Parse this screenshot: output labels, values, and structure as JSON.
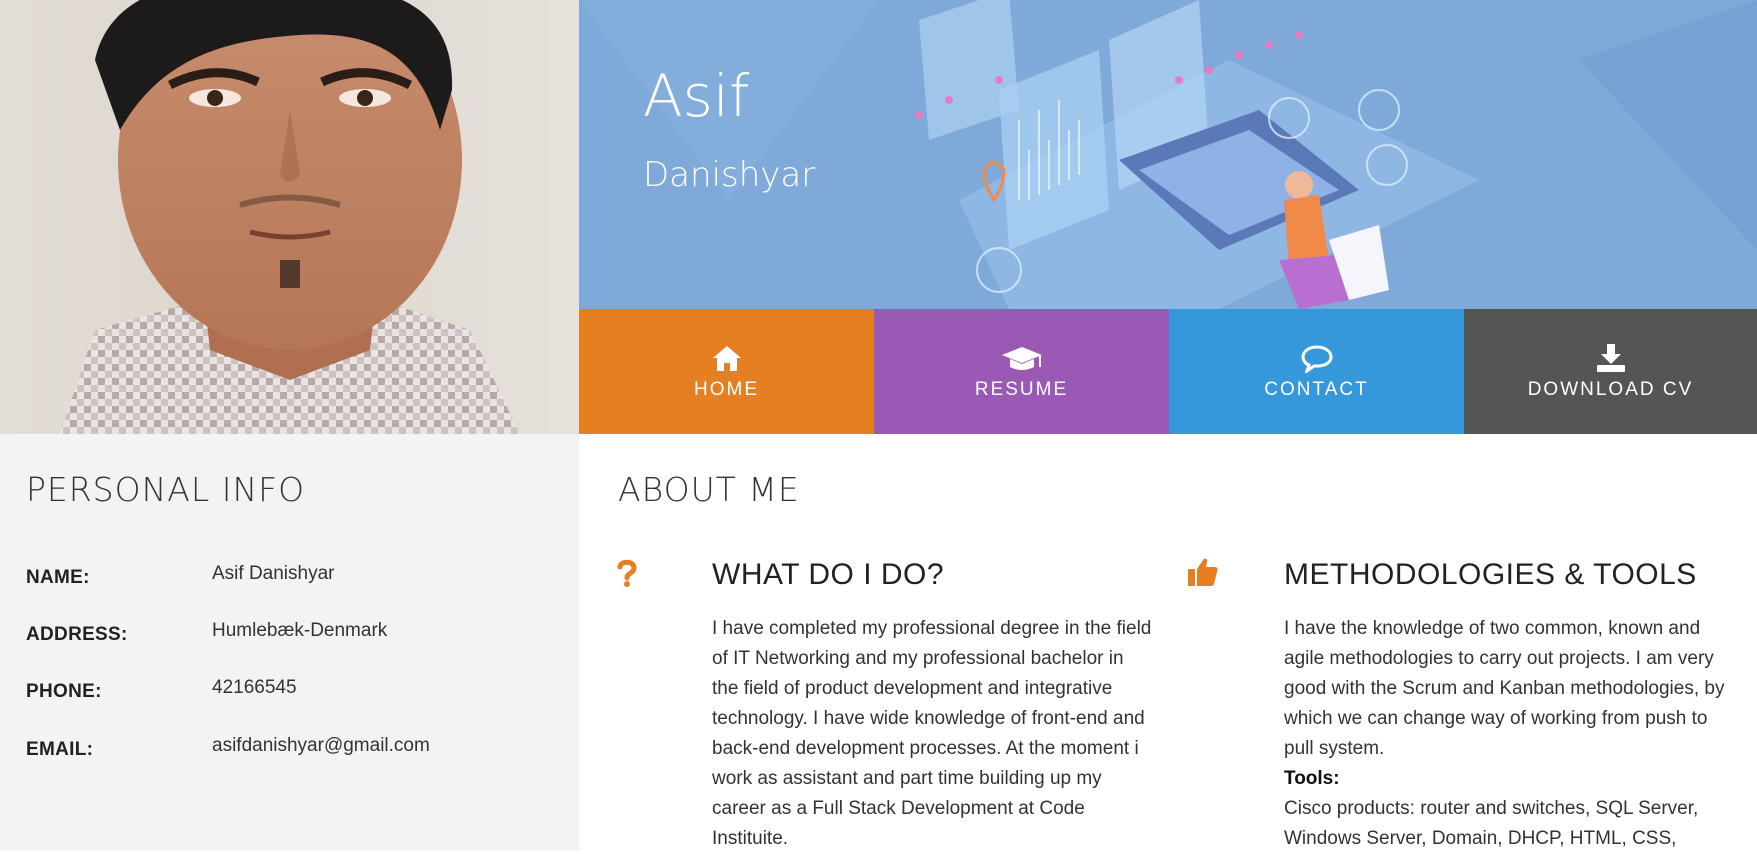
{
  "colors": {
    "home": "#e67e22",
    "resume": "#9b59b6",
    "contact": "#3498db",
    "download": "#555555",
    "accent": "#e67e22",
    "hero": "#7fa9d8",
    "sidebar": "#f3f3f3"
  },
  "profile": {
    "photo_alt": "Portrait photo"
  },
  "hero": {
    "first_name": "Asif",
    "last_name": "Danishyar"
  },
  "nav": [
    {
      "label": "HOME",
      "icon": "home-icon"
    },
    {
      "label": "RESUME",
      "icon": "graduation-cap-icon"
    },
    {
      "label": "CONTACT",
      "icon": "speech-bubble-icon"
    },
    {
      "label": "DOWNLOAD CV",
      "icon": "download-icon"
    }
  ],
  "personal": {
    "title": "PERSONAL INFO",
    "rows": [
      {
        "label": "NAME:",
        "value": "Asif Danishyar"
      },
      {
        "label": "ADDRESS:",
        "value": "Humlebæk-Denmark"
      },
      {
        "label": "PHONE:",
        "value": "42166545"
      },
      {
        "label": "EMAIL:",
        "value": "asifdanishyar@gmail.com"
      }
    ]
  },
  "about": {
    "title": "ABOUT ME",
    "features": [
      {
        "icon": "question-mark-icon",
        "title": "WHAT DO I DO?",
        "text": "I have completed my professional degree in the field of IT Networking and my professional bachelor in the field of product development and integrative technology. I have wide knowledge of front-end and back-end development processes. At the moment i work as assistant and part time building up my career as a Full Stack Development at Code Instituite."
      },
      {
        "icon": "thumbs-up-icon",
        "title": "METHODOLOGIES & TOOLS",
        "text": "I have the knowledge of two common, known and agile methodologies to carry out projects. I am very good with the Scrum and Kanban methodologies, by which we can change way of working from push to pull system.",
        "tools_label": "Tools:",
        "tools_text": "Cisco products: router and switches, SQL Server, Windows Server, Domain, DHCP, HTML, CSS,"
      }
    ]
  }
}
